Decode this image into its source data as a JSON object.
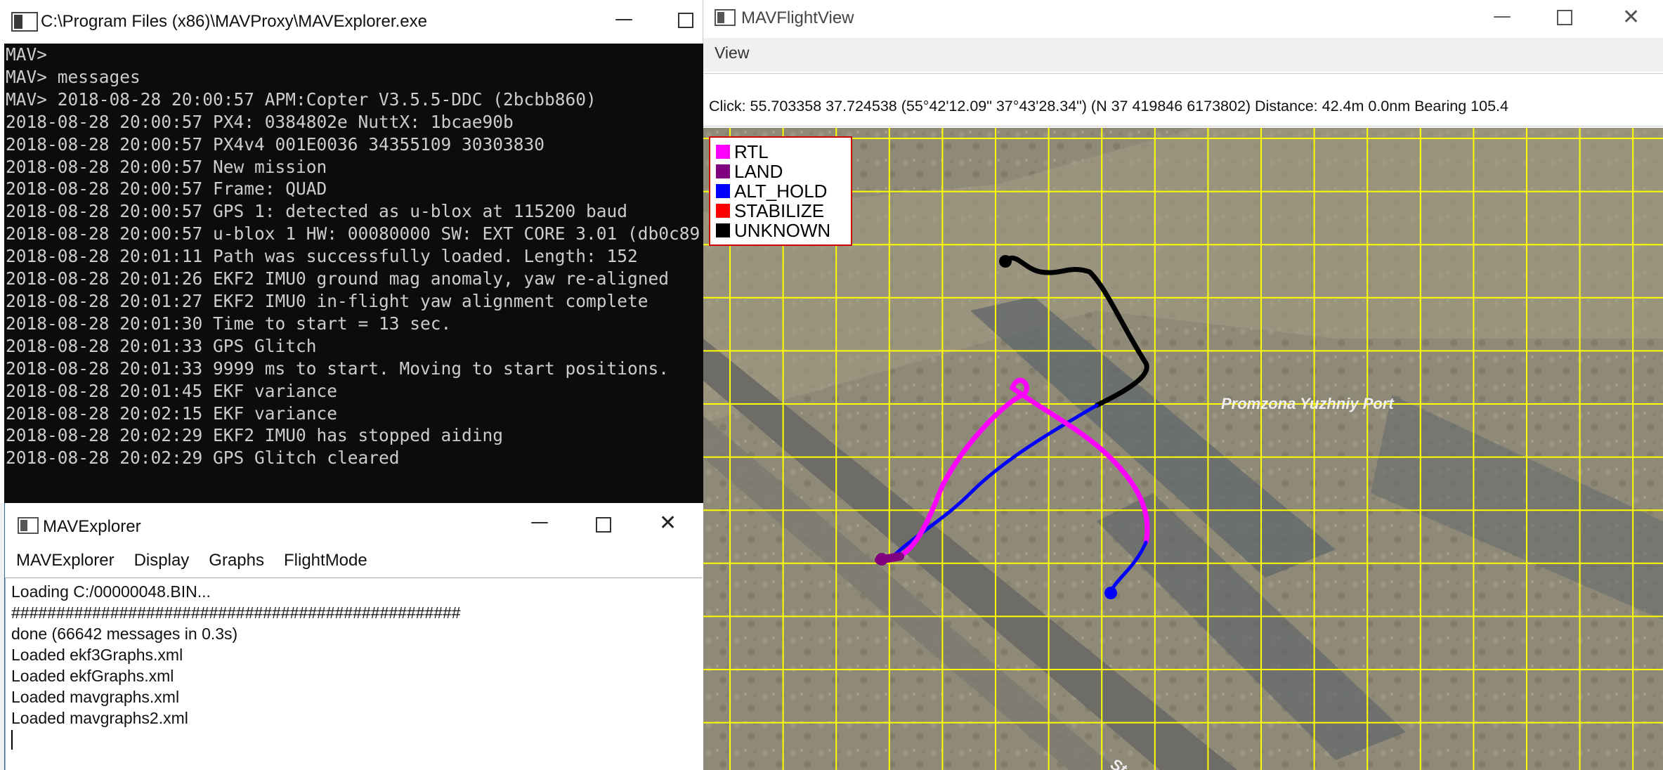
{
  "console": {
    "title": "C:\\Program Files (x86)\\MAVProxy\\MAVExplorer.exe",
    "lines": [
      "MAV>",
      "MAV> messages",
      "MAV> 2018-08-28 20:00:57 APM:Copter V3.5.5-DDC (2bcbb860)",
      "2018-08-28 20:00:57 PX4: 0384802e NuttX: 1bcae90b",
      "2018-08-28 20:00:57 PX4v4 001E0036 34355109 30303830",
      "2018-08-28 20:00:57 New mission",
      "2018-08-28 20:00:57 Frame: QUAD",
      "2018-08-28 20:00:57 GPS 1: detected as u-blox at 115200 baud",
      "2018-08-28 20:00:57 u-blox 1 HW: 00080000 SW: EXT CORE 3.01 (db0c89",
      "2018-08-28 20:01:11 Path was successfully loaded. Length: 152",
      "2018-08-28 20:01:26 EKF2 IMU0 ground mag anomaly, yaw re-aligned",
      "2018-08-28 20:01:27 EKF2 IMU0 in-flight yaw alignment complete",
      "2018-08-28 20:01:30 Time to start = 13 sec.",
      "2018-08-28 20:01:33 GPS Glitch",
      "2018-08-28 20:01:33 9999 ms to start. Moving to start positions.",
      "2018-08-28 20:01:45 EKF variance",
      "2018-08-28 20:02:15 EKF variance",
      "2018-08-28 20:02:29 EKF2 IMU0 has stopped aiding",
      "2018-08-28 20:02:29 GPS Glitch cleared"
    ]
  },
  "explorer": {
    "title": "MAVExplorer",
    "menu": [
      "MAVExplorer",
      "Display",
      "Graphs",
      "FlightMode"
    ],
    "log": [
      "Loading C:/00000048.BIN...",
      "##################################################",
      "done (66642 messages in 0.3s)",
      "Loaded ekf3Graphs.xml",
      "Loaded ekfGraphs.xml",
      "Loaded mavgraphs.xml",
      "Loaded mavgraphs2.xml"
    ]
  },
  "flightview": {
    "title": "MAVFlightView",
    "menu_view": "View",
    "status": "Click: 55.703358 37.724538 (55°42'12.09\" 37°43'28.34\") (N 37 419846 6173802)  Distance: 42.4m 0.0nm Bearing 105.4",
    "map_label": "Promzona Yuzhniy Port",
    "map_label_partial": "St",
    "legend": [
      {
        "label": "RTL",
        "color": "#ff00ff"
      },
      {
        "label": "LAND",
        "color": "#800080"
      },
      {
        "label": "ALT_HOLD",
        "color": "#0000ff"
      },
      {
        "label": "STABILIZE",
        "color": "#ff0000"
      },
      {
        "label": "UNKNOWN",
        "color": "#000000"
      }
    ]
  },
  "colors": {
    "grid": "#ffff00",
    "console_bg": "#0c0c0c",
    "console_text": "#cccccc"
  }
}
